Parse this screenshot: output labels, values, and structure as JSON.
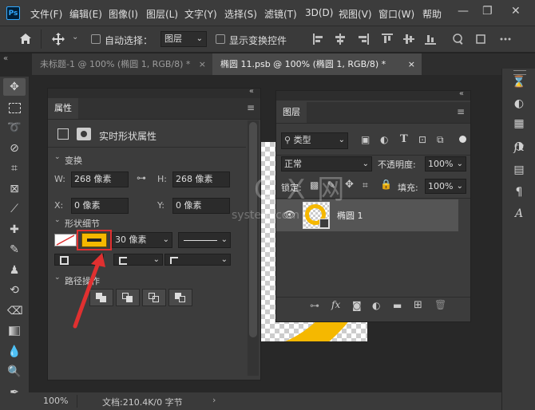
{
  "app": {
    "logo": "Ps"
  },
  "menu": [
    "文件(F)",
    "编辑(E)",
    "图像(I)",
    "图层(L)",
    "文字(Y)",
    "选择(S)",
    "滤镜(T)",
    "3D(D)",
    "视图(V)",
    "窗口(W)",
    "帮助"
  ],
  "window_controls": {
    "minimize": "—",
    "restore": "❐",
    "close": "✕"
  },
  "options": {
    "home_icon": "home-icon",
    "auto_select_label": "自动选择：",
    "auto_select_target": "图层",
    "show_transform_label": "显示变换控件"
  },
  "tabs": [
    {
      "label": "未标题-1 @ 100% (椭圆 1, RGB/8) *",
      "active": false
    },
    {
      "label": "椭圆 11.psb @ 100% (椭圆 1, RGB/8) *",
      "active": true
    }
  ],
  "tab_close": "×",
  "collapse_glyph": "«",
  "properties": {
    "title": "属性",
    "subtitle": "实时形状属性",
    "section_transform": "变换",
    "w_label": "W:",
    "w_value": "268 像素",
    "h_label": "H:",
    "h_value": "268 像素",
    "x_label": "X:",
    "x_value": "0 像素",
    "y_label": "Y:",
    "y_value": "0 像素",
    "section_shape": "形状细节",
    "stroke_width": "30 像素",
    "section_path": "路径操作"
  },
  "layers": {
    "title": "图层",
    "filter_kind": "类型",
    "blend_mode": "正常",
    "opacity_label": "不透明度:",
    "opacity_value": "100%",
    "lock_label": "锁定:",
    "fill_label": "填充:",
    "fill_value": "100%",
    "layer_name": "椭圆 1"
  },
  "status": {
    "zoom": "100%",
    "doc_info": "文档:210.4K/0 字节"
  },
  "watermark": {
    "big": "G X 网",
    "small": "system.com"
  },
  "colors": {
    "accent_yellow": "#f5b800",
    "highlight_red": "#e03030",
    "panel_bg": "#3c3c3c"
  }
}
